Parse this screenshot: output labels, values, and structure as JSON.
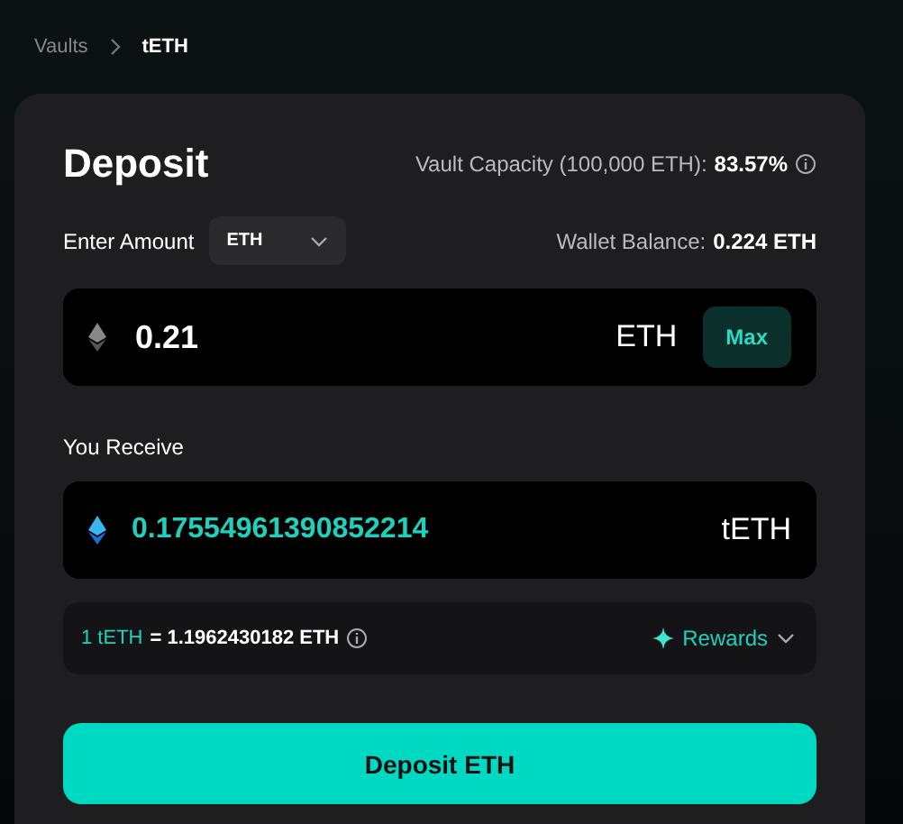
{
  "breadcrumb": [
    {
      "label": "Vaults",
      "current": false
    },
    {
      "label": "tETH",
      "current": true
    }
  ],
  "card": {
    "title": "Deposit",
    "capacity_label": "Vault Capacity (100,000 ETH):",
    "capacity_value": "83.57%",
    "amount_label": "Enter Amount",
    "token_select": "ETH",
    "balance_label": "Wallet Balance:",
    "balance_value": "0.224 ETH",
    "amount": {
      "value": "0.21",
      "unit": "ETH",
      "max_button": "Max"
    },
    "receive_label": "You Receive",
    "receive": {
      "value": "0.17554961390852214",
      "unit": "tETH"
    },
    "rate": {
      "token": "1 tETH",
      "value": "= 1.1962430182 ETH",
      "rewards": "Rewards",
      "rewards_expanded": false
    },
    "submit": "Deposit ETH"
  }
}
